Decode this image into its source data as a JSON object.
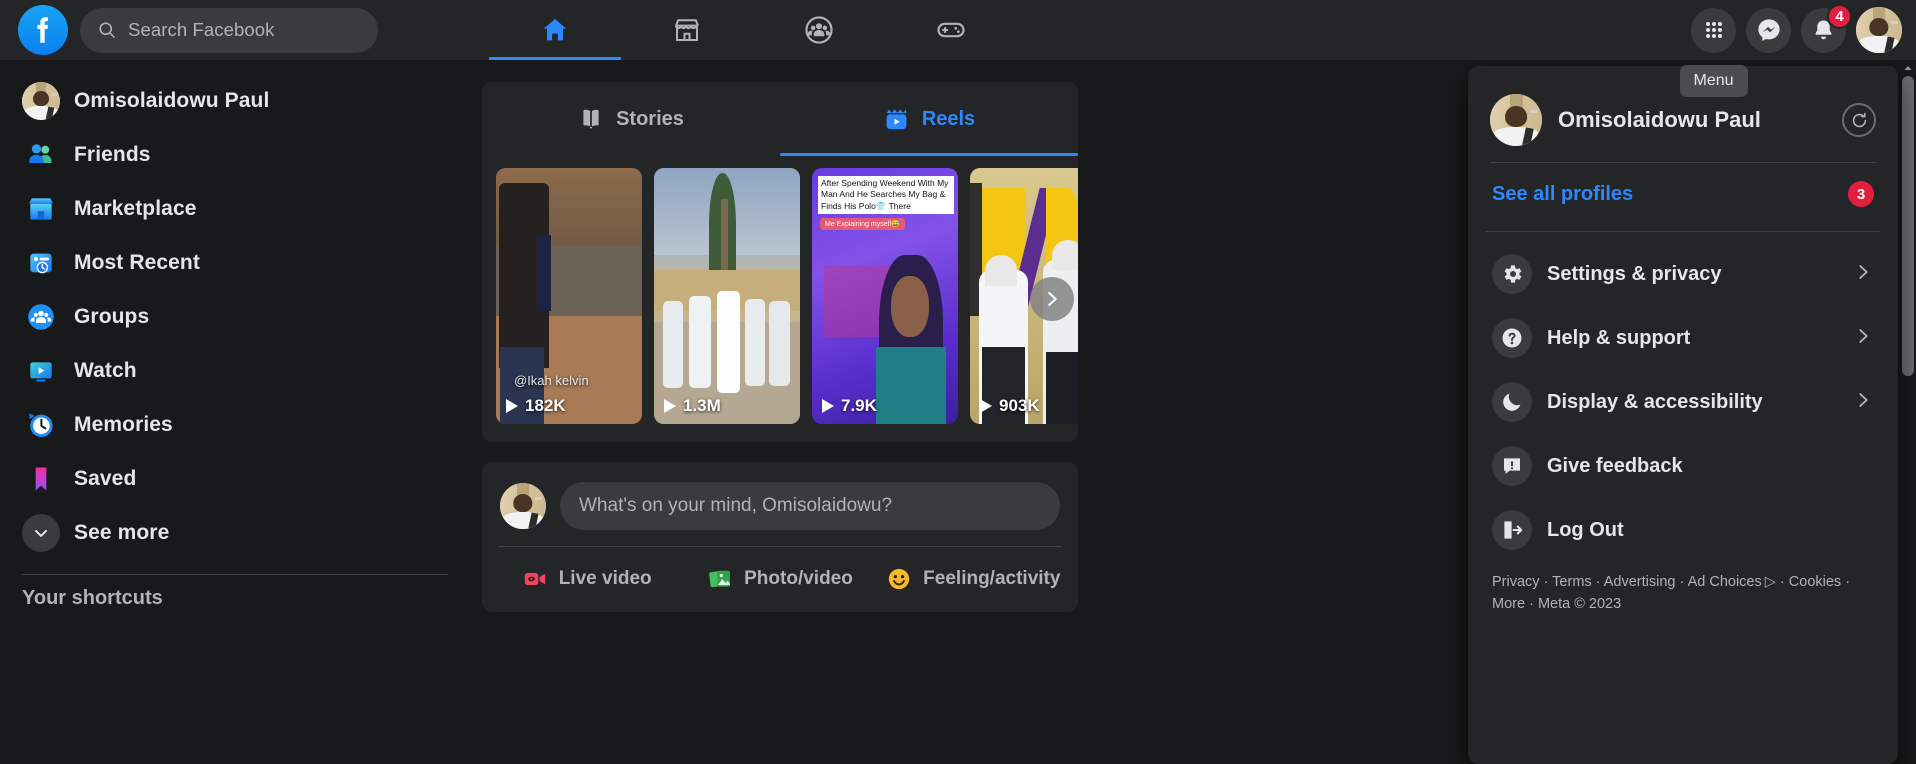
{
  "topbar": {
    "logo_icon": "facebook-logo-icon",
    "search": {
      "placeholder": "Search Facebook",
      "value": "",
      "icon": "search-icon"
    },
    "nav_tabs": [
      {
        "name": "home",
        "icon": "home-icon",
        "active": true
      },
      {
        "name": "marketplace",
        "icon": "marketplace-icon",
        "active": false
      },
      {
        "name": "groups",
        "icon": "groups-icon",
        "active": false
      },
      {
        "name": "gaming",
        "icon": "gaming-controller-icon",
        "active": false
      }
    ],
    "menu_button": {
      "icon": "grid-menu-icon",
      "tooltip": "Menu"
    },
    "messenger_button": {
      "icon": "messenger-icon"
    },
    "notifications_button": {
      "icon": "bell-icon",
      "badge": "4"
    },
    "account_button": {
      "icon": "user-avatar"
    }
  },
  "sidebar": {
    "items": [
      {
        "label": "Omisolaidowu Paul",
        "icon": "user-avatar"
      },
      {
        "label": "Friends",
        "icon": "friends-icon"
      },
      {
        "label": "Marketplace",
        "icon": "marketplace-icon"
      },
      {
        "label": "Most Recent",
        "icon": "most-recent-icon"
      },
      {
        "label": "Groups",
        "icon": "groups-icon"
      },
      {
        "label": "Watch",
        "icon": "watch-icon"
      },
      {
        "label": "Memories",
        "icon": "memories-clock-icon"
      },
      {
        "label": "Saved",
        "icon": "saved-bookmark-icon"
      },
      {
        "label": "See more",
        "icon": "chevron-down-icon"
      }
    ],
    "shortcuts_title": "Your shortcuts"
  },
  "feed": {
    "reels_card": {
      "tabs": [
        {
          "label": "Stories",
          "icon": "stories-book-icon",
          "active": false
        },
        {
          "label": "Reels",
          "icon": "reels-clapper-icon",
          "active": true
        }
      ],
      "next_button_icon": "chevron-right-icon",
      "reels": [
        {
          "views": "182K",
          "handle": "@Ikah kelvin",
          "play_icon": "play-icon"
        },
        {
          "views": "1.3M",
          "handle": "",
          "play_icon": "play-icon"
        },
        {
          "views": "7.9K",
          "handle": "",
          "play_icon": "play-icon",
          "caption": "After Spending Weekend With My Man And He Searches My Bag & Finds His Polo👕 There",
          "caption2": "Me Explaining myself😅"
        },
        {
          "views": "903K",
          "handle": "",
          "play_icon": "play-icon"
        }
      ]
    },
    "composer": {
      "placeholder": "What's on your mind, Omisolaidowu?",
      "avatar_icon": "user-avatar",
      "actions": [
        {
          "label": "Live video",
          "icon": "live-video-icon",
          "color": "#f3425f"
        },
        {
          "label": "Photo/video",
          "icon": "photo-video-icon",
          "color": "#45bd62"
        },
        {
          "label": "Feeling/activity",
          "icon": "feeling-activity-icon",
          "color": "#f7b928"
        }
      ]
    }
  },
  "menu_panel": {
    "profile": {
      "name": "Omisolaidowu Paul",
      "avatar_icon": "user-avatar",
      "switch_icon": "refresh-account-icon"
    },
    "see_all_profiles": {
      "label": "See all profiles",
      "badge": "3"
    },
    "items": [
      {
        "label": "Settings & privacy",
        "icon": "gear-icon",
        "chevron": "chevron-right-icon"
      },
      {
        "label": "Help & support",
        "icon": "question-mark-icon",
        "chevron": "chevron-right-icon"
      },
      {
        "label": "Display & accessibility",
        "icon": "moon-icon",
        "chevron": "chevron-right-icon"
      },
      {
        "label": "Give feedback",
        "icon": "feedback-icon",
        "chevron": ""
      },
      {
        "label": "Log Out",
        "icon": "log-out-icon",
        "chevron": ""
      }
    ],
    "footer": {
      "line1_parts": [
        "Privacy",
        "Terms",
        "Advertising",
        "Ad Choices",
        "Cookies"
      ],
      "ad_choices_glyph": "▷",
      "line2_parts": [
        "More",
        "Meta © 2023"
      ],
      "separator": " · "
    }
  },
  "colors": {
    "accent_blue": "#2d88ff",
    "badge_red": "#e41e3f",
    "panel_bg": "#242526",
    "page_bg": "#18191a",
    "text_primary": "#e4e6eb",
    "text_secondary": "#b0b3b8"
  }
}
